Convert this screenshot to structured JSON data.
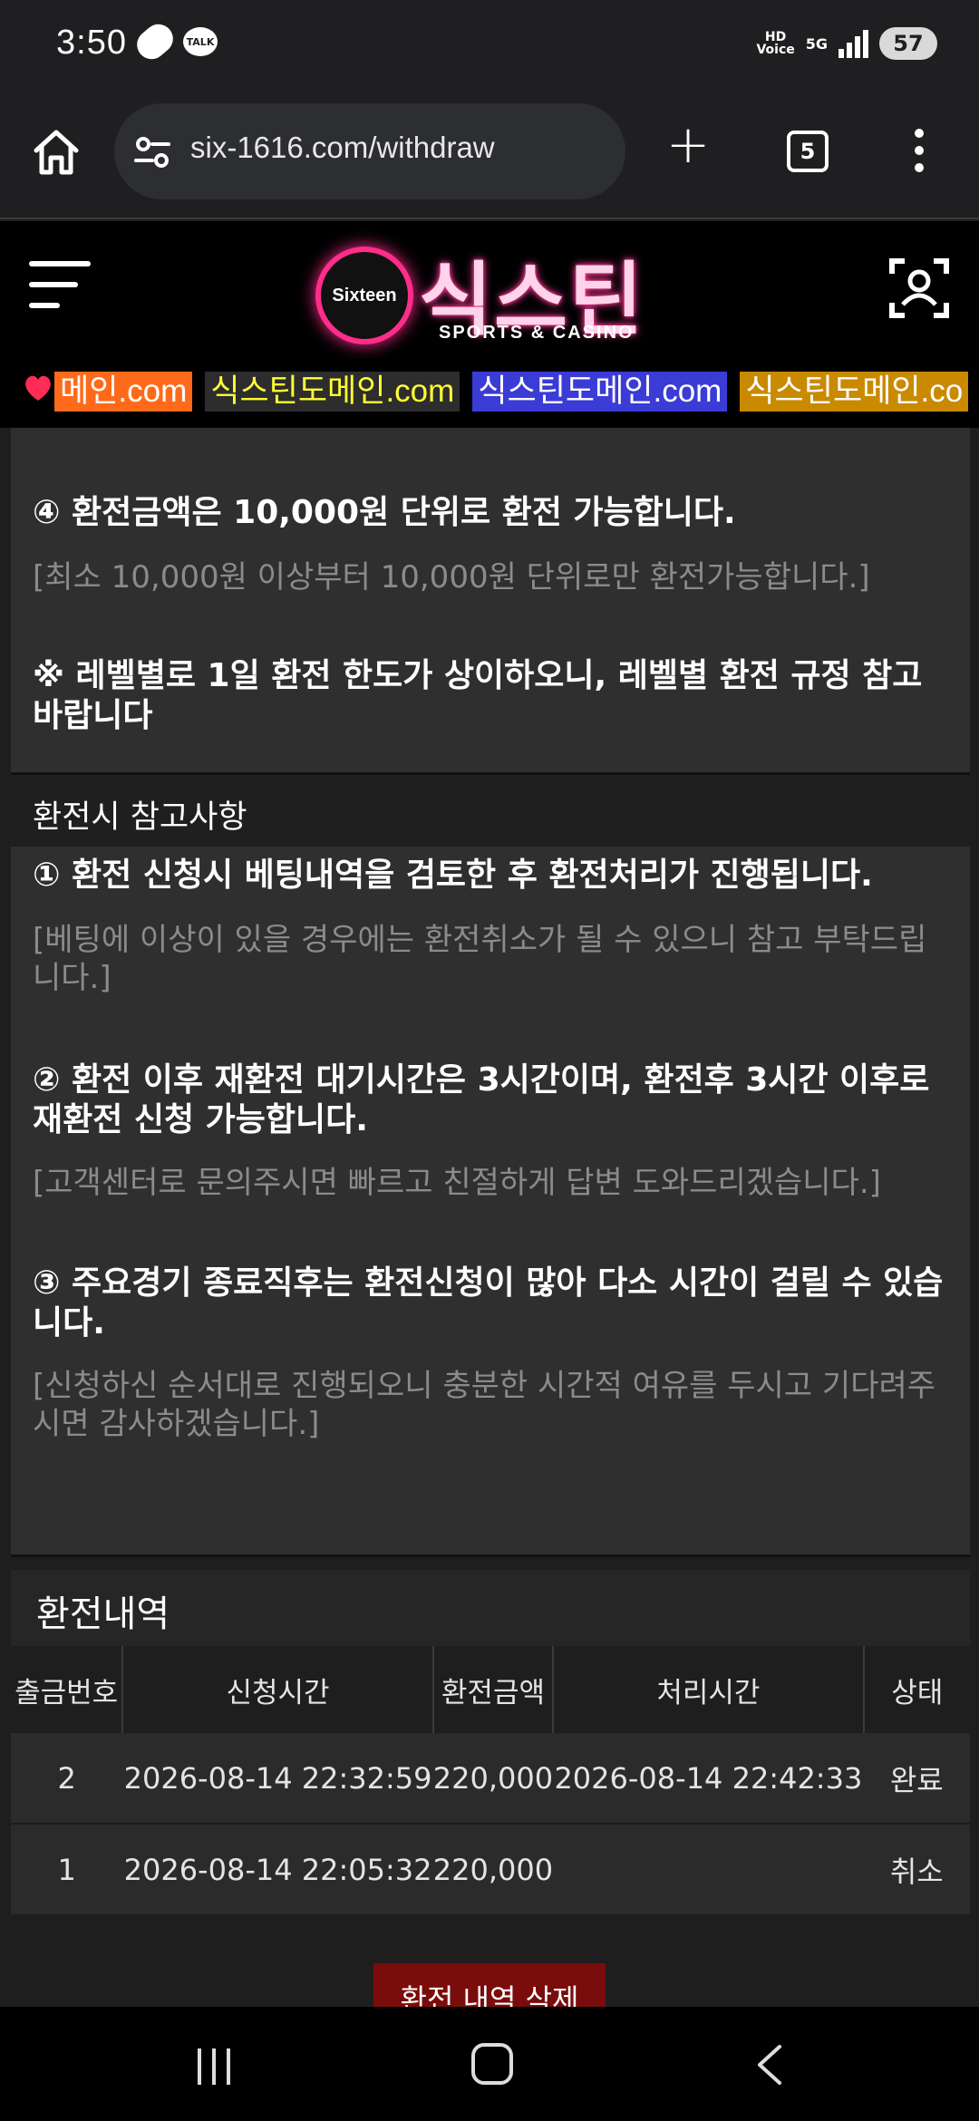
{
  "status_bar": {
    "time": "3:50",
    "talk_badge": "TALK",
    "hd_voice": "HD\nVoice",
    "network": "5G",
    "battery": "57"
  },
  "browser": {
    "url": "six-1616.com/withdraw",
    "tab_count": "5"
  },
  "site": {
    "logo_badge": "Sixteen",
    "logo_title": "식스틴",
    "logo_sub": "SPORTS & CASINO"
  },
  "ticker": {
    "items": [
      {
        "text": "메인.com",
        "bg": "#ff6a1a",
        "fg": "#ffffff"
      },
      {
        "text": "식스틴도메인.com",
        "bg": "#2d2d2d",
        "fg": "#ffff33"
      },
      {
        "text": "식스틴도메인.com",
        "bg": "#3b3bd6",
        "fg": "#ffffff"
      },
      {
        "text": "식스틴도메인.co",
        "bg": "#c98a00",
        "fg": "#ffffff"
      }
    ]
  },
  "rules": {
    "rule4_head": "④ 환전금액은 10,000원 단위로 환전 가능합니다.",
    "rule4_sub": "[최소 10,000원 이상부터 10,000원 단위로만 환전가능합니다.]",
    "level_note": "※ 레벨별로 1일 환전 한도가 상이하오니, 레벨별 환전 규정 참고바랍니다",
    "section_title": "환전시 참고사항",
    "note1_head": "① 환전 신청시 베팅내역을 검토한 후 환전처리가 진행됩니다.",
    "note1_sub": "[베팅에 이상이 있을 경우에는 환전취소가 될 수 있으니 참고 부탁드립니다.]",
    "note2_head": "② 환전 이후 재환전 대기시간은 3시간이며, 환전후 3시간 이후로 재환전 신청 가능합니다.",
    "note2_sub": "[고객센터로 문의주시면 빠르고 친절하게 답변 도와드리겠습니다.]",
    "note3_head": "③ 주요경기 종료직후는 환전신청이 많아 다소 시간이 걸릴 수 있습니다.",
    "note3_sub": "[신청하신 순서대로 진행되오니 충분한 시간적 여유를 두시고 기다려주시면 감사하겠습니다.]"
  },
  "history": {
    "title": "환전내역",
    "columns": [
      "출금번호",
      "신청시간",
      "환전금액",
      "처리시간",
      "상태"
    ],
    "rows": [
      [
        "2",
        "2026-08-14 22:32:59",
        "220,000",
        "2026-08-14 22:42:33",
        "완료"
      ],
      [
        "1",
        "2026-08-14 22:05:32",
        "220,000",
        "",
        "취소"
      ]
    ],
    "delete_label": "환전 내역 삭제"
  }
}
